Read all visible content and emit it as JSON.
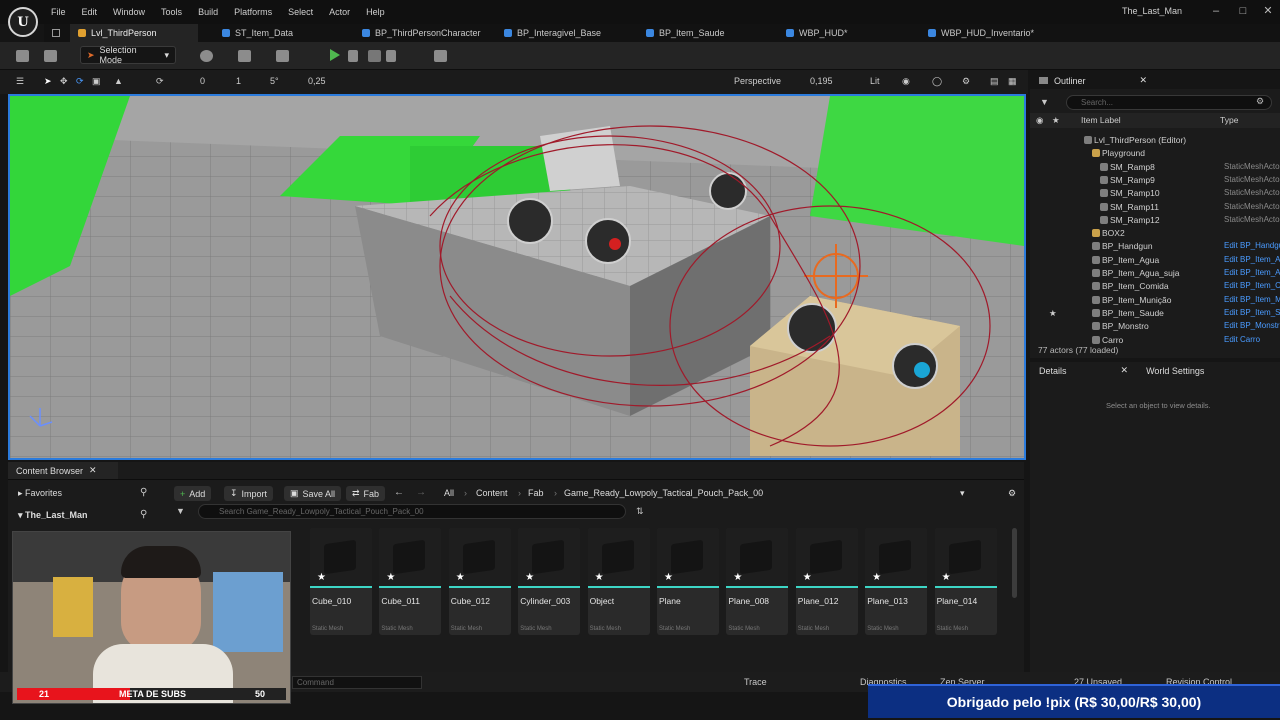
{
  "app": {
    "logo": "U",
    "menu": [
      "File",
      "Edit",
      "Window",
      "Tools",
      "Build",
      "Platforms",
      "Select",
      "Actor",
      "Help"
    ],
    "project_name": "The_Last_Man",
    "window_controls": [
      "minimize-icon",
      "maximize-icon",
      "close-icon"
    ]
  },
  "tabs": [
    {
      "label": "Lvl_ThirdPerson",
      "active": true,
      "color": "#e0a030"
    },
    {
      "label": "ST_Item_Data",
      "active": false,
      "color": "#3b87e0"
    },
    {
      "label": "BP_ThirdPersonCharacter",
      "active": false,
      "color": "#3b87e0"
    },
    {
      "label": "BP_Interagivel_Base",
      "active": false,
      "color": "#3b87e0"
    },
    {
      "label": "BP_Item_Saude",
      "active": false,
      "color": "#3b87e0"
    },
    {
      "label": "WBP_HUD*",
      "active": false,
      "color": "#3b87e0"
    },
    {
      "label": "WBP_HUD_Inventario*",
      "active": false,
      "color": "#3b87e0"
    }
  ],
  "toolbar": {
    "selection_mode": "Selection Mode"
  },
  "viewport_toolbar": {
    "rotation_snap": "0",
    "grid_snap": "1",
    "angle_snap": "5°",
    "scale_snap": "0,25",
    "view_mode": "Perspective",
    "camera_speed": "0,195",
    "lighting": "Lit"
  },
  "outliner": {
    "title": "Outliner",
    "search_placeholder": "Search...",
    "col_label": "Item Label",
    "col_type": "Type",
    "rows": [
      {
        "label": "Lvl_ThirdPerson (Editor)",
        "type": "",
        "indent": 0,
        "link": false
      },
      {
        "label": "Playground",
        "type": "",
        "indent": 1,
        "link": false
      },
      {
        "label": "SM_Ramp8",
        "type": "StaticMeshActor",
        "indent": 2,
        "link": false
      },
      {
        "label": "SM_Ramp9",
        "type": "StaticMeshActor",
        "indent": 2,
        "link": false
      },
      {
        "label": "SM_Ramp10",
        "type": "StaticMeshActor",
        "indent": 2,
        "link": false
      },
      {
        "label": "SM_Ramp11",
        "type": "StaticMeshActor",
        "indent": 2,
        "link": false
      },
      {
        "label": "SM_Ramp12",
        "type": "StaticMeshActor",
        "indent": 2,
        "link": false
      },
      {
        "label": "BOX2",
        "type": "",
        "indent": 1,
        "link": false
      },
      {
        "label": "BP_Handgun",
        "type": "Edit BP_Handgun",
        "indent": 1,
        "link": true
      },
      {
        "label": "BP_Item_Agua",
        "type": "Edit BP_Item_Agua",
        "indent": 1,
        "link": true
      },
      {
        "label": "BP_Item_Agua_suja",
        "type": "Edit BP_Item_Agua_suja",
        "indent": 1,
        "link": true
      },
      {
        "label": "BP_Item_Comida",
        "type": "Edit BP_Item_Comida",
        "indent": 1,
        "link": true
      },
      {
        "label": "BP_Item_Munição",
        "type": "Edit BP_Item_Munição",
        "indent": 1,
        "link": true
      },
      {
        "label": "BP_Item_Saude",
        "type": "Edit BP_Item_Saude",
        "indent": 1,
        "link": true
      },
      {
        "label": "BP_Monstro",
        "type": "Edit BP_Monstro",
        "indent": 1,
        "link": true
      },
      {
        "label": "Carro",
        "type": "Edit Carro",
        "indent": 1,
        "link": true
      }
    ],
    "actor_count": "77 actors (77 loaded)"
  },
  "details": {
    "tab_details": "Details",
    "tab_world": "World Settings",
    "empty_msg": "Select an object to view details."
  },
  "content_browser": {
    "tab": "Content Browser",
    "favorites": "Favorites",
    "project": "The_Last_Man",
    "add": "Add",
    "import": "Import",
    "save_all": "Save All",
    "fab": "Fab",
    "breadcrumbs": [
      "All",
      "Content",
      "Fab",
      "Game_Ready_Lowpoly_Tactical_Pouch_Pack_00"
    ],
    "search_placeholder": "Search Game_Ready_Lowpoly_Tactical_Pouch_Pack_00",
    "assets": [
      {
        "name": "Cube_010",
        "kind": "Static Mesh"
      },
      {
        "name": "Cube_011",
        "kind": "Static Mesh"
      },
      {
        "name": "Cube_012",
        "kind": "Static Mesh"
      },
      {
        "name": "Cylinder_003",
        "kind": "Static Mesh"
      },
      {
        "name": "Object",
        "kind": "Static Mesh"
      },
      {
        "name": "Plane",
        "kind": "Static Mesh"
      },
      {
        "name": "Plane_008",
        "kind": "Static Mesh"
      },
      {
        "name": "Plane_012",
        "kind": "Static Mesh"
      },
      {
        "name": "Plane_013",
        "kind": "Static Mesh"
      },
      {
        "name": "Plane_014",
        "kind": "Static Mesh"
      }
    ]
  },
  "statusbar": {
    "cmd_placeholder": "Command",
    "trace": "Trace",
    "diagnostics": "Diagnostics",
    "zen": "Zen Server",
    "unsaved": "27 Unsaved",
    "revision": "Revision Control"
  },
  "overlay": {
    "subs_current": "21",
    "subs_label": "META DE SUBS",
    "subs_goal": "50",
    "subs_progress": 0.42,
    "donation": "Obrigado pelo !pix (R$ 30,00/R$ 30,00)"
  }
}
